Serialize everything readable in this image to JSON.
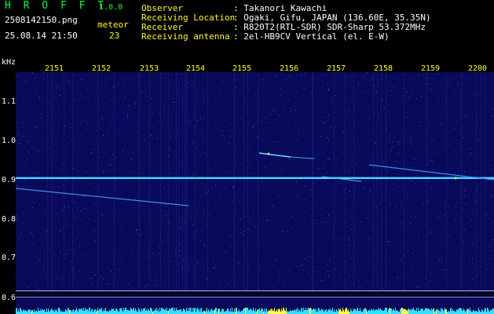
{
  "header": {
    "app_name": "H R O F F T",
    "version": "1.0.0",
    "filename": "2508142150.png",
    "datetime": "25.08.14 21:50",
    "meteor_label": "meteor",
    "meteor_count": "23",
    "info": [
      {
        "key": "Observer",
        "value": ": Takanori Kawachi"
      },
      {
        "key": "Receiving Location",
        "value": ": Ogaki, Gifu, JAPAN (136.60E, 35.35N)"
      },
      {
        "key": "Receiver",
        "value": ": R820T2(RTL-SDR) SDR-Sharp 53.372MHz"
      },
      {
        "key": "Receiving antenna",
        "value": ": 2el-HB9CV Vertical (el. E-W)"
      }
    ]
  },
  "axis": {
    "unit_label": "kHz",
    "time_ticks": [
      "2151",
      "2152",
      "2153",
      "2154",
      "2155",
      "2156",
      "2157",
      "2158",
      "2159",
      "2200"
    ],
    "freq_ticks": [
      "1.1",
      "1.0",
      "0.9",
      "0.8",
      "0.7",
      "0.6"
    ]
  },
  "colors": {
    "background": "#0a0a5a",
    "carrier": "#4ad8ff",
    "label_green": "#00ff3c",
    "label_yellow": "#ffff00"
  }
}
